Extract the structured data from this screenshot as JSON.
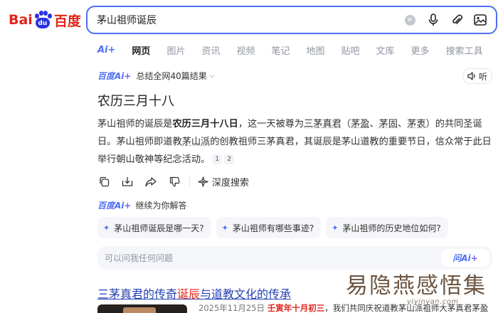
{
  "logo": {
    "bai": "Bai",
    "du_paw": "du",
    "cn": "百度"
  },
  "search": {
    "query": "茅山祖师诞辰"
  },
  "tabs": [
    {
      "label": "Ai+"
    },
    {
      "label": "网页"
    },
    {
      "label": "图片"
    },
    {
      "label": "资讯"
    },
    {
      "label": "视频"
    },
    {
      "label": "笔记"
    },
    {
      "label": "地图"
    },
    {
      "label": "贴吧"
    },
    {
      "label": "文库"
    },
    {
      "label": "更多"
    },
    {
      "label": "搜索工具"
    }
  ],
  "ai": {
    "brand": "百度",
    "brand_ai": "Ai",
    "brand_plus": "+",
    "summary": "总结全网40篇结果",
    "listen_label": "听",
    "answer_title": "农历三月十八",
    "p1_a": "茅山祖师的诞辰是",
    "p1_b": "农历三月十八日",
    "p1_c": "，这一天被尊为",
    "p1_d": "三茅真君",
    "p1_e": "（",
    "p1_f": "茅盈",
    "p1_g": "、",
    "p1_h": "茅固",
    "p1_i": "、",
    "p1_j": "茅衷",
    "p1_k": "）的共同圣诞日。茅山祖师即道教",
    "p1_l": "茅山派",
    "p1_m": "的创教祖师三茅真君，其诞辰是茅山道教的重要节日，信众常于此日举行朝山敬神等纪念活动。",
    "cite1": "1",
    "cite2": "2",
    "deep_search": "深度搜索",
    "follow_title": "继续为你解答",
    "chips": [
      "茅山祖师诞辰是哪一天?",
      "茅山祖师有哪些事迹?",
      "茅山祖师的历史地位如何?"
    ],
    "ask_placeholder": "可以问我任何问题",
    "ask_btn_cn": "问",
    "ask_btn_ai": "Ai",
    "ask_btn_plus": "+"
  },
  "result": {
    "title_a": "三茅真君的传奇",
    "title_hl": "诞辰",
    "title_b": "与道教文化的传承",
    "date": "2025年11月25日",
    "lunar": "壬寅年十月初三",
    "snippet": "，我们共同庆祝道教茅山派祖师大茅真君茅盈"
  },
  "watermark": {
    "text": "易隐燕感悟集",
    "url": "yiyinyan.com"
  },
  "colors": {
    "brand_blue": "#4e6ef2",
    "brand_red": "#e1251b",
    "link": "#2440b3"
  }
}
